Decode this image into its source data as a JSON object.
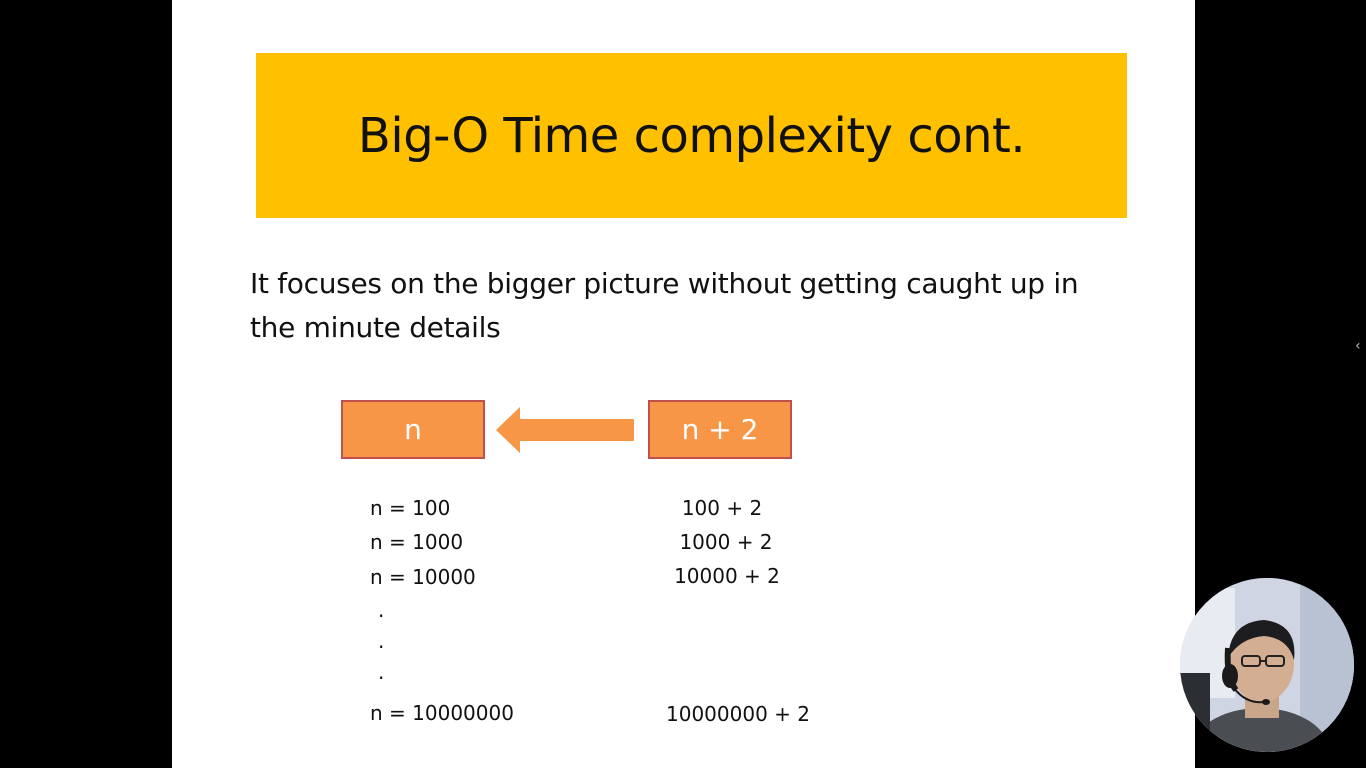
{
  "slide": {
    "title": "Big-O Time complexity cont.",
    "body_line1": "It focuses on the bigger picture without getting caught up in",
    "body_line2": "the minute details",
    "box_left_label": "n",
    "box_right_label": "n + 2",
    "left_column": {
      "row1": "n = 100",
      "row2": "n = 1000",
      "row3": "n = 10000",
      "dot1": ".",
      "dot2": ".",
      "dot3": ".",
      "row_last": "n = 10000000"
    },
    "right_column": {
      "row1": "100 + 2",
      "row2": "1000 + 2",
      "row3": "10000 + 2",
      "row_last": "10000000 + 2"
    }
  },
  "colors": {
    "banner": "#ffc000",
    "box_fill": "#f79646",
    "box_border": "#c0504d",
    "arrow": "#f79646"
  },
  "icons": {
    "side_nav": "chevron-left-icon"
  },
  "side_nav_glyph": "‹"
}
